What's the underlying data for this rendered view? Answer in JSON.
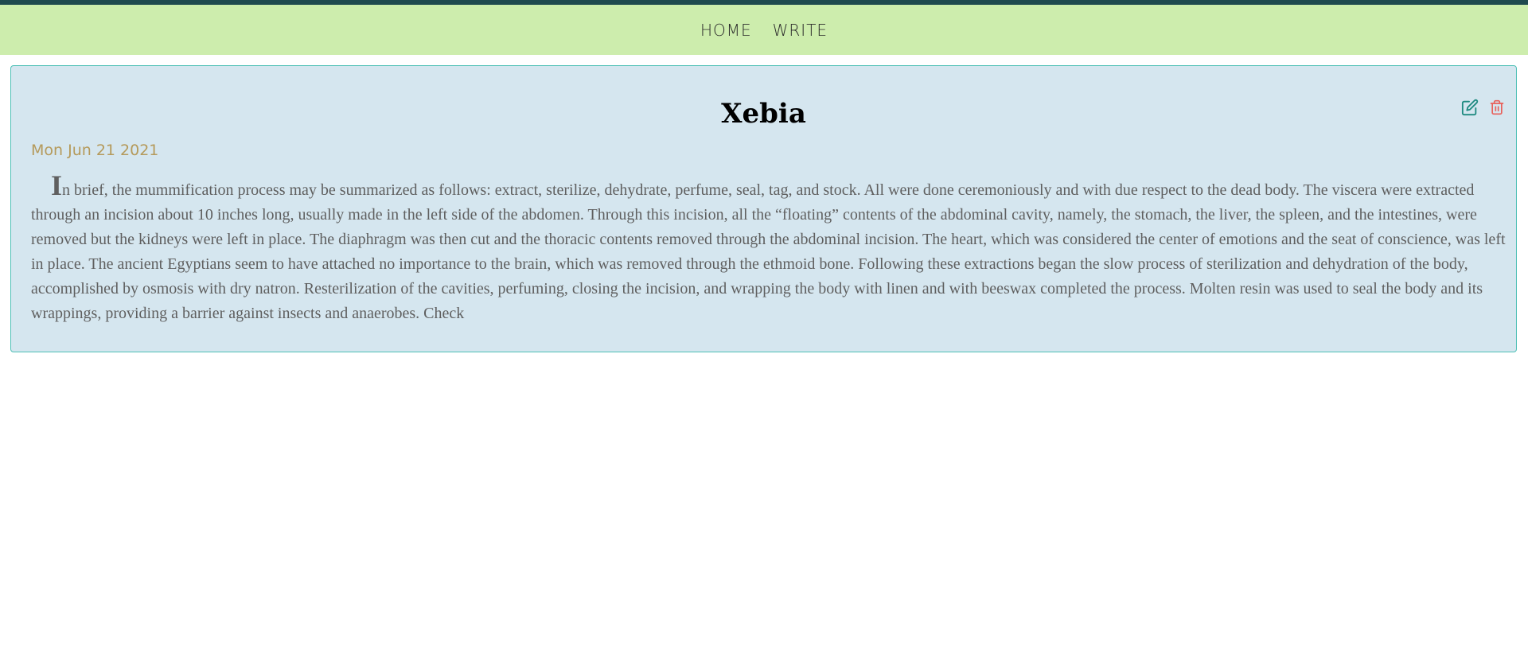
{
  "nav": {
    "items": [
      {
        "label": "HOME"
      },
      {
        "label": "WRITE"
      }
    ]
  },
  "post": {
    "title": "Xebia",
    "date": "Mon Jun 21 2021",
    "body_first_letter": "I",
    "body_rest": "n brief, the mummification process may be summarized as follows: extract, sterilize, dehydrate, perfume, seal, tag, and stock. All were done ceremoniously and with due respect to the dead body. The viscera were extracted through an incision about 10 inches long, usually made in the left side of the abdomen. Through this incision, all the “floating” contents of the abdominal cavity, namely, the stomach, the liver, the spleen, and the intestines, were removed but the kidneys were left in place. The diaphragm was then cut and the thoracic contents removed through the abdominal incision. The heart, which was considered the center of emotions and the seat of conscience, was left in place. The ancient Egyptians seem to have attached no importance to the brain, which was removed through the ethmoid bone. Following these extractions began the slow process of sterilization and dehydration of the body, accomplished by osmosis with dry natron. Resterilization of the cavities, perfuming, closing the incision, and wrapping the body with linen and with beeswax completed the process. Molten resin was used to seal the body and its wrappings, providing a barrier against insects and anaerobes. Check",
    "actions": {
      "edit_icon": "edit-icon",
      "delete_icon": "trash-icon"
    }
  },
  "colors": {
    "top_strip": "#1f4a4f",
    "navbar_bg": "#cdedad",
    "card_bg": "#d5e6ef",
    "card_border": "#4fc0b6",
    "date": "#b59a5b",
    "edit_icon": "#1e8a80",
    "delete_icon": "#e8605a"
  }
}
